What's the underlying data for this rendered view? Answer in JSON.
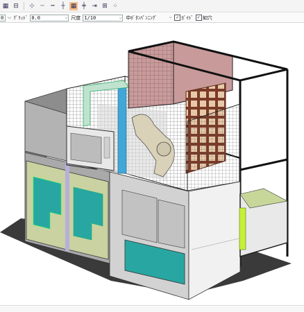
{
  "toolbar": {
    "icons": [
      "grid-icon",
      "layers-icon",
      "axis-line-icon",
      "dash-line-icon",
      "dash-line-2-icon",
      "cross-icon",
      "highlight-grid-icon",
      "ruler-icon",
      "snap-icon",
      "table-grid-icon",
      "dots-grid-icon"
    ]
  },
  "options": {
    "first_field": "0",
    "grid_label": "ｸﾞﾘｯﾄﾞ",
    "grid_value": "0.0",
    "scale_label": "尺度",
    "scale_value": "1/10",
    "snap_value": "中ﾎﾞﾀﾝﾊﾟﾝﾆﾝｸﾞ",
    "check1_label": "ｶﾞｲﾄﾞ",
    "check2_label": "如穴"
  },
  "colors": {
    "panel_green": "#c9d2a0",
    "panel_teal": "#28a7a2",
    "enclosure_gray": "#b9b9b9",
    "frame_dark": "#222222",
    "pink_panel": "#c89a9a",
    "lime_accent": "#c4ef3a"
  }
}
